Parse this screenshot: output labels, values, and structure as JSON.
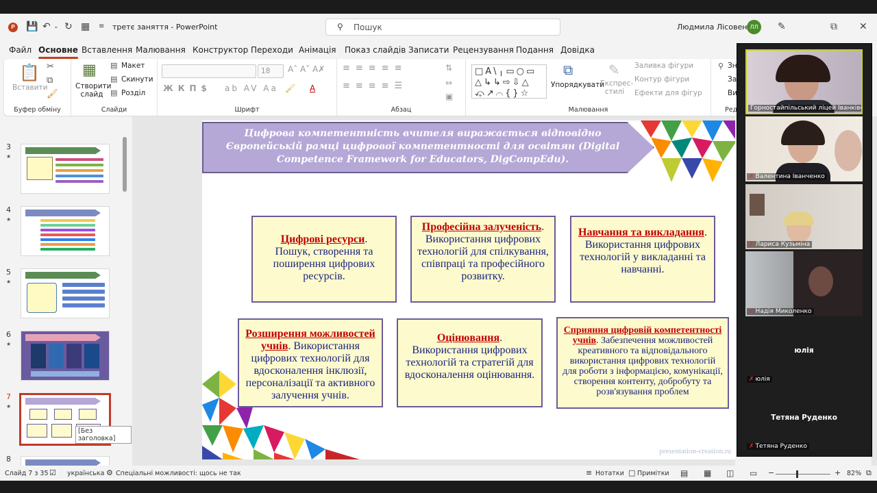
{
  "titlebar": {
    "doc_title": "третє заняття  -  PowerPoint",
    "search_placeholder": "Пошук",
    "user": "Людмила Лісовенко",
    "user_initials": "ЛЛ",
    "app_badge": "P"
  },
  "tabs": [
    "Файл",
    "Основне",
    "Вставлення",
    "Малювання",
    "Конструктор",
    "Переходи",
    "Анімація",
    "Показ слайдів",
    "Записати",
    "Рецензування",
    "Подання",
    "Довідка"
  ],
  "ribbon": {
    "clipboard": {
      "label": "Буфер обміну",
      "paste": "Вставити"
    },
    "slides": {
      "label": "Слайди",
      "new_slide": "Створити слайд",
      "layout": "Макет",
      "reset": "Скинути",
      "section": "Розділ"
    },
    "font": {
      "label": "Шрифт",
      "size": "18"
    },
    "paragraph": {
      "label": "Абзац"
    },
    "drawing": {
      "label": "Малювання",
      "arrange": "Упорядкувати",
      "styles": "Експрес-стилі",
      "fill": "Заливка фігури",
      "outline": "Контур фігури",
      "effects": "Ефекти для фігур"
    },
    "edit": {
      "find": "Зн",
      "replace": "За",
      "select": "Ви",
      "label": "Ред"
    }
  },
  "thumbnails": [
    {
      "num": "3"
    },
    {
      "num": "4"
    },
    {
      "num": "5"
    },
    {
      "num": "6"
    },
    {
      "num": "7"
    },
    {
      "num": "8"
    }
  ],
  "tooltip": "[Без заголовка]",
  "slide": {
    "banner_line1": "Цифрова компетентність вчителя виражається відповідно",
    "banner_line2": "Європейській рамці цифрової компетентності для освітян (Digital",
    "banner_line3": "Competence Framework for Educators, DigCompEdu).",
    "boxes": [
      {
        "title": "Цифрові ресурси",
        "title_suffix": ".",
        "body": "Пошук, створення та поширення цифрових ресурсів."
      },
      {
        "title": "Професійна залученість",
        "title_suffix": ".",
        "body": "Використання цифрових технологій для спілкування, співпраці та професійного розвитку."
      },
      {
        "title": "Навчання та викладання",
        "title_suffix": ".",
        "body": "Використання цифрових технологій у викладанні та навчанні."
      },
      {
        "title": "Розширення можливостей учнів",
        "title_suffix": ".",
        "body": " Використання цифрових технологій для вдосконалення інклюзії, персоналізації та активного залучення учнів."
      },
      {
        "title": "Оцінювання",
        "title_suffix": ".",
        "body": "Використання цифрових технологій та стратегій для вдосконалення оцінювання."
      },
      {
        "title": "Сприяння цифровій компетентності учнів",
        "title_suffix": ".",
        "body": " Забезпечення можливостей креативного та відповідального використання цифрових технологій для роботи з інформацією, комунікації, створення контенту, добробуту та розв'язування проблем"
      }
    ],
    "watermark": "presentation-creation.ru"
  },
  "statusbar": {
    "slide": "Слайд 7 з 35",
    "language": "українська",
    "accessibility": "Спеціальні можливості: щось не так",
    "notes": "Нотатки",
    "comments": "Примітки",
    "zoom": "82%"
  },
  "video": [
    {
      "name": "Горностайпільський ліцей Іванківської с..."
    },
    {
      "name": "Валентина Іванченко"
    },
    {
      "name": "Лариса Кузьміна"
    },
    {
      "name": "Надія Миколенко"
    },
    {
      "name": "юлія",
      "center": "юлія"
    },
    {
      "name": "Тетяна Руденко",
      "center": "Тетяна Руденко"
    }
  ]
}
